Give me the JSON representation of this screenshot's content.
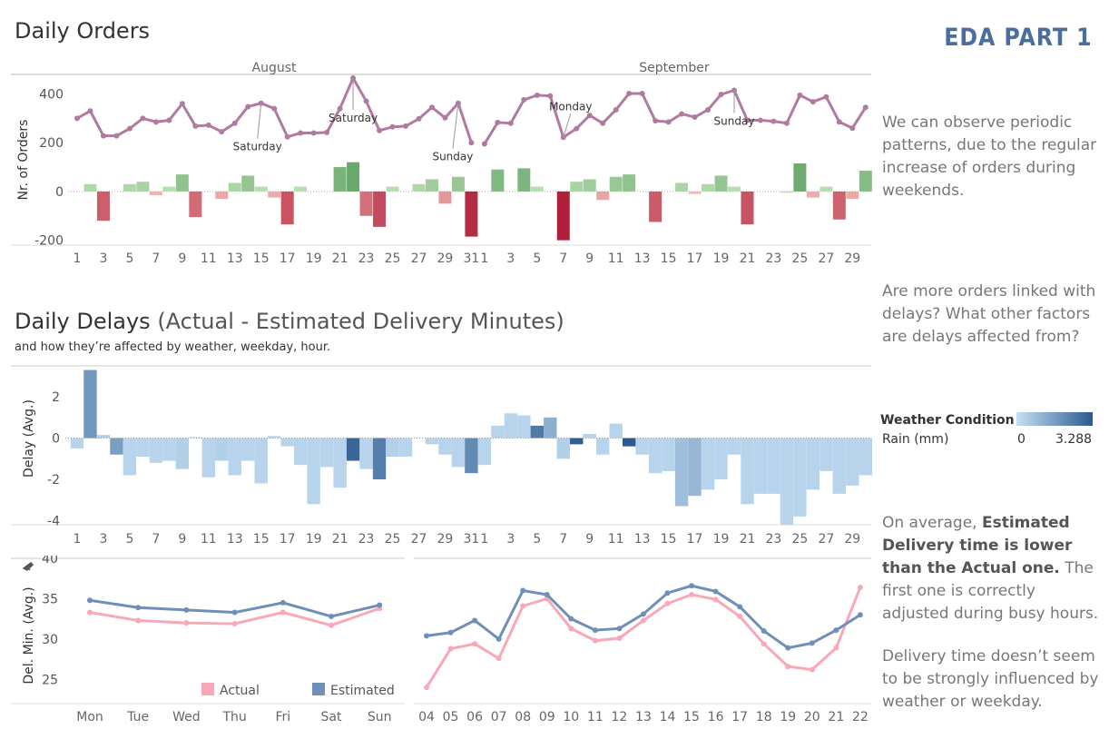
{
  "header": {
    "orders_title": "Daily Orders",
    "badge": "EDA PART 1"
  },
  "delays": {
    "title_main": "Daily Delays",
    "title_sub": " (Actual - Estimated Delivery Minutes)",
    "subtitle": "and how they’re affected by weather, weekday, hour."
  },
  "notes": {
    "n1": "We can observe periodic patterns, due to the regular increase of orders during weekends.",
    "n2": "Are more orders linked with delays? What other factors are delays affected from?",
    "n3_a": "On average, ",
    "n3_b": "Estimated Delivery time is lower than the Actual one.",
    "n3_c": " The first one is correctly adjusted during busy hours.",
    "n4": "Delivery time doesn’t seem to be strongly influenced by weather or weekday."
  },
  "legend": {
    "title": "Weather Condition",
    "sub": "Rain (mm)",
    "min": "0",
    "max": "3.288",
    "color_low": "#c6e0f5",
    "color_high": "#2b5a8f"
  },
  "chart_data": [
    {
      "type": "line",
      "name": "daily-orders",
      "months": [
        "August",
        "September"
      ],
      "x_labels": [
        "1",
        "",
        "3",
        "",
        "5",
        "",
        "7",
        "",
        "9",
        "",
        "11",
        "",
        "13",
        "",
        "15",
        "",
        "17",
        "",
        "19",
        "",
        "21",
        "",
        "23",
        "",
        "25",
        "",
        "27",
        "",
        "29",
        "",
        "31",
        "1",
        "",
        "3",
        "",
        "5",
        "",
        "7",
        "",
        "9",
        "",
        "11",
        "",
        "13",
        "",
        "15",
        "",
        "17",
        "",
        "19",
        "",
        "21",
        "",
        "23",
        "",
        "25",
        "",
        "27",
        "",
        "29",
        ""
      ],
      "ylabel": "Nr. of Orders",
      "yticks": [
        400,
        200,
        0,
        -200
      ],
      "ylim": [
        -220,
        480
      ],
      "orders": [
        300,
        330,
        228,
        228,
        258,
        300,
        285,
        292,
        360,
        268,
        272,
        245,
        280,
        348,
        362,
        340,
        224,
        240,
        240,
        242,
        340,
        465,
        370,
        250,
        265,
        268,
        298,
        345,
        302,
        362,
        200,
        195,
        283,
        280,
        376,
        395,
        392,
        222,
        258,
        312,
        280,
        335,
        402,
        402,
        290,
        285,
        318,
        305,
        335,
        398,
        415,
        292,
        292,
        288,
        280,
        395,
        368,
        388,
        285,
        260,
        345
      ],
      "diff": [
        0,
        30,
        -120,
        0,
        30,
        40,
        -15,
        20,
        70,
        -105,
        0,
        -30,
        35,
        65,
        20,
        -25,
        -135,
        20,
        0,
        0,
        100,
        120,
        -100,
        -145,
        20,
        0,
        30,
        50,
        -50,
        60,
        -185,
        0,
        90,
        0,
        95,
        20,
        0,
        -200,
        40,
        50,
        -35,
        60,
        70,
        0,
        -125,
        0,
        35,
        -10,
        30,
        65,
        20,
        -135,
        0,
        0,
        -5,
        115,
        -25,
        20,
        -115,
        -30,
        85
      ],
      "line_color": "#b07aa1",
      "annotations": [
        {
          "label": "Saturday",
          "index": 14
        },
        {
          "label": "Saturday",
          "index": 21
        },
        {
          "label": "Sunday",
          "index": 29
        },
        {
          "label": "Monday",
          "index": 37
        },
        {
          "label": "Sunday",
          "index": 50
        }
      ]
    },
    {
      "type": "bar",
      "name": "daily-delays",
      "ylabel": "Delay (Avg.)",
      "yticks": [
        2,
        0,
        -2,
        -4
      ],
      "ylim": [
        -4.2,
        3.5
      ],
      "delay": [
        -0.5,
        3.3,
        0.15,
        -0.8,
        -1.8,
        -0.9,
        -1.2,
        -1.1,
        -1.5,
        0.05,
        -1.9,
        -1.1,
        -1.8,
        -1.1,
        -2.2,
        0.1,
        -0.4,
        -1.3,
        -3.2,
        -1.4,
        -2.4,
        -1.1,
        -1.5,
        -2.0,
        -0.9,
        -0.9,
        0,
        -0.3,
        -0.8,
        -1.4,
        -1.7,
        -1.3,
        0.6,
        1.2,
        1.1,
        0.6,
        1.0,
        -1.0,
        -0.3,
        0.2,
        -0.8,
        0.7,
        -0.4,
        -0.8,
        -1.7,
        -1.6,
        -3.3,
        -2.8,
        -2.5,
        -2.0,
        -0.8,
        -3.2,
        -2.7,
        -2.7,
        -4.2,
        -3.8,
        -2.5,
        -1.6,
        -2.7,
        -2.3,
        -1.8
      ],
      "rain": [
        0.3,
        1.8,
        0.4,
        1.6,
        0.3,
        0.3,
        0.3,
        0.3,
        0.4,
        0.3,
        0.3,
        0.4,
        0.3,
        0.3,
        0.3,
        0.3,
        0.3,
        0.3,
        0.3,
        0.3,
        0.3,
        3.0,
        0.3,
        2.4,
        0.4,
        0.3,
        0.3,
        0.3,
        0.3,
        0.3,
        2.1,
        0.3,
        0.3,
        0.3,
        0.3,
        2.5,
        1.2,
        0.4,
        3.2,
        0.3,
        0.3,
        0.3,
        3.3,
        0.3,
        0.3,
        0.3,
        0.8,
        1.0,
        0.3,
        0.3,
        0.3,
        0.3,
        0.3,
        0.3,
        0.3,
        0.3,
        0.3,
        0.3,
        0.3,
        0.3,
        0.3
      ]
    },
    {
      "type": "line",
      "name": "weekday-delivery",
      "ylabel": "Del. Min. (Avg.)",
      "categories": [
        "Mon",
        "Tue",
        "Wed",
        "Thu",
        "Fri",
        "Sat",
        "Sun"
      ],
      "yticks": [
        40,
        35,
        30,
        25
      ],
      "ylim": [
        22,
        40
      ],
      "series": [
        {
          "name": "Actual",
          "color": "#f9a8b8",
          "values": [
            33.3,
            32.3,
            32.0,
            31.9,
            33.3,
            31.7,
            33.8
          ]
        },
        {
          "name": "Estimated",
          "color": "#6f8fb8",
          "values": [
            34.8,
            33.9,
            33.6,
            33.3,
            34.5,
            32.8,
            34.2
          ]
        }
      ]
    },
    {
      "type": "line",
      "name": "hourly-delivery",
      "categories": [
        "04",
        "05",
        "06",
        "07",
        "08",
        "09",
        "10",
        "11",
        "12",
        "13",
        "14",
        "15",
        "16",
        "17",
        "18",
        "19",
        "20",
        "21",
        "22"
      ],
      "ylim": [
        22,
        40
      ],
      "series": [
        {
          "name": "Actual",
          "color": "#f9a8b8",
          "values": [
            24.0,
            28.8,
            29.4,
            27.6,
            34.1,
            35.0,
            31.3,
            29.8,
            30.1,
            32.3,
            34.4,
            35.5,
            34.9,
            32.8,
            29.4,
            26.6,
            26.2,
            28.9,
            36.4
          ]
        },
        {
          "name": "Estimated",
          "color": "#6f8fb8",
          "values": [
            30.4,
            30.8,
            32.3,
            30.0,
            36.0,
            35.5,
            32.5,
            31.1,
            31.3,
            33.1,
            35.7,
            36.6,
            35.9,
            34.0,
            31.0,
            28.9,
            29.5,
            31.1,
            33.0
          ]
        }
      ]
    }
  ]
}
